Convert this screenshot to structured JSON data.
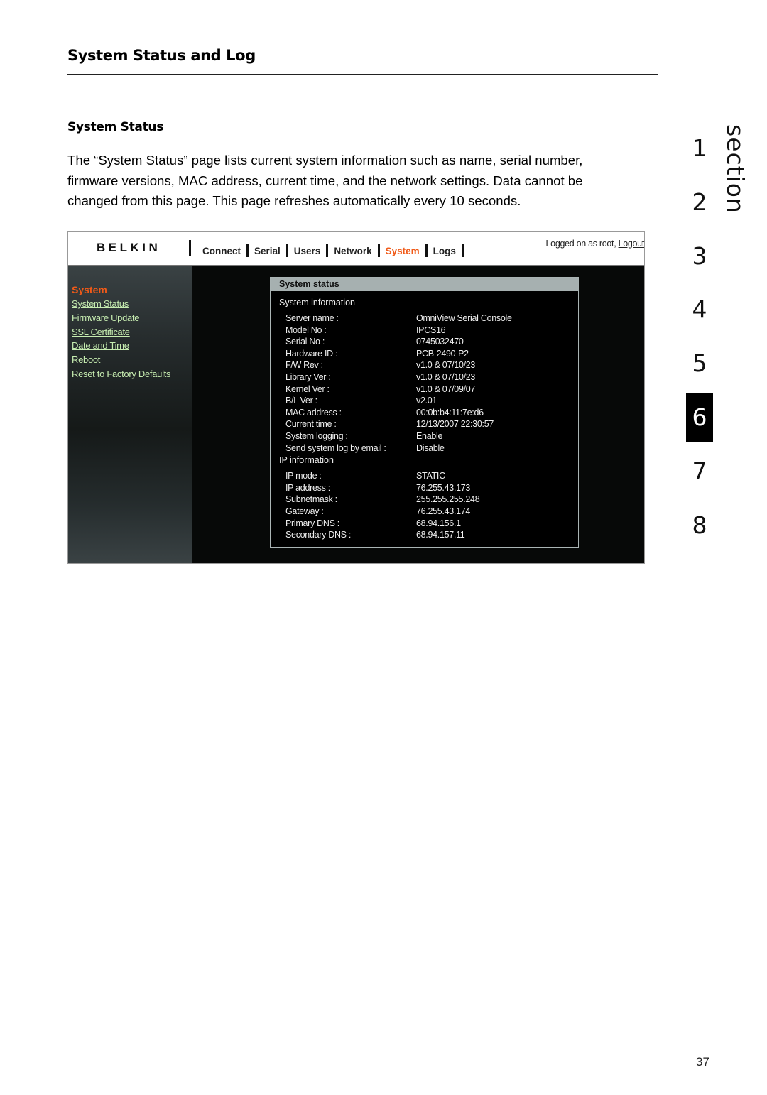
{
  "page": {
    "title": "System Status and Log",
    "subtitle": "System Status",
    "body": "The “System Status” page lists current system information such as name, serial number, firmware versions, MAC address, current time, and the network settings. Data cannot be changed from this page. This page refreshes automatically every 10 seconds.",
    "page_number": "37"
  },
  "section_tabs": {
    "label": "section",
    "numbers": [
      "1",
      "2",
      "3",
      "4",
      "5",
      "6",
      "7",
      "8"
    ],
    "active": "6"
  },
  "screenshot": {
    "logo": "BELKIN",
    "nav": [
      {
        "label": "Connect",
        "active": false
      },
      {
        "label": "Serial",
        "active": false
      },
      {
        "label": "Users",
        "active": false
      },
      {
        "label": "Network",
        "active": false
      },
      {
        "label": "System",
        "active": true
      },
      {
        "label": "Logs",
        "active": false
      }
    ],
    "login_text": "Logged on as root, ",
    "logout_label": "Logout",
    "sidebar": {
      "heading": "System",
      "links": [
        "System Status",
        "Firmware Update",
        "SSL Certificate",
        "Date and Time",
        "Reboot",
        "Reset to Factory Defaults"
      ]
    },
    "panel": {
      "title": "System status",
      "system_info_heading": "System information",
      "system_info": [
        {
          "k": "Server name :",
          "v": "OmniView Serial Console"
        },
        {
          "k": "Model No :",
          "v": "IPCS16"
        },
        {
          "k": "Serial No :",
          "v": "0745032470"
        },
        {
          "k": "Hardware ID :",
          "v": "PCB-2490-P2"
        },
        {
          "k": "F/W Rev :",
          "v": "v1.0 & 07/10/23"
        },
        {
          "k": "Library Ver :",
          "v": "v1.0 & 07/10/23"
        },
        {
          "k": "Kernel Ver :",
          "v": "v1.0 & 07/09/07"
        },
        {
          "k": "B/L Ver :",
          "v": "v2.01"
        },
        {
          "k": "MAC address :",
          "v": "00:0b:b4:11:7e:d6"
        },
        {
          "k": "Current time :",
          "v": "12/13/2007 22:30:57"
        },
        {
          "k": "System logging :",
          "v": "Enable"
        },
        {
          "k": "Send system log by email :",
          "v": "Disable"
        }
      ],
      "ip_info_heading": "IP information",
      "ip_info": [
        {
          "k": "IP mode :",
          "v": "STATIC"
        },
        {
          "k": "IP address :",
          "v": "76.255.43.173"
        },
        {
          "k": "Subnetmask :",
          "v": "255.255.255.248"
        },
        {
          "k": "Gateway :",
          "v": "76.255.43.174"
        },
        {
          "k": "Primary DNS :",
          "v": "68.94.156.1"
        },
        {
          "k": "Secondary DNS :",
          "v": "68.94.157.11"
        }
      ]
    }
  }
}
